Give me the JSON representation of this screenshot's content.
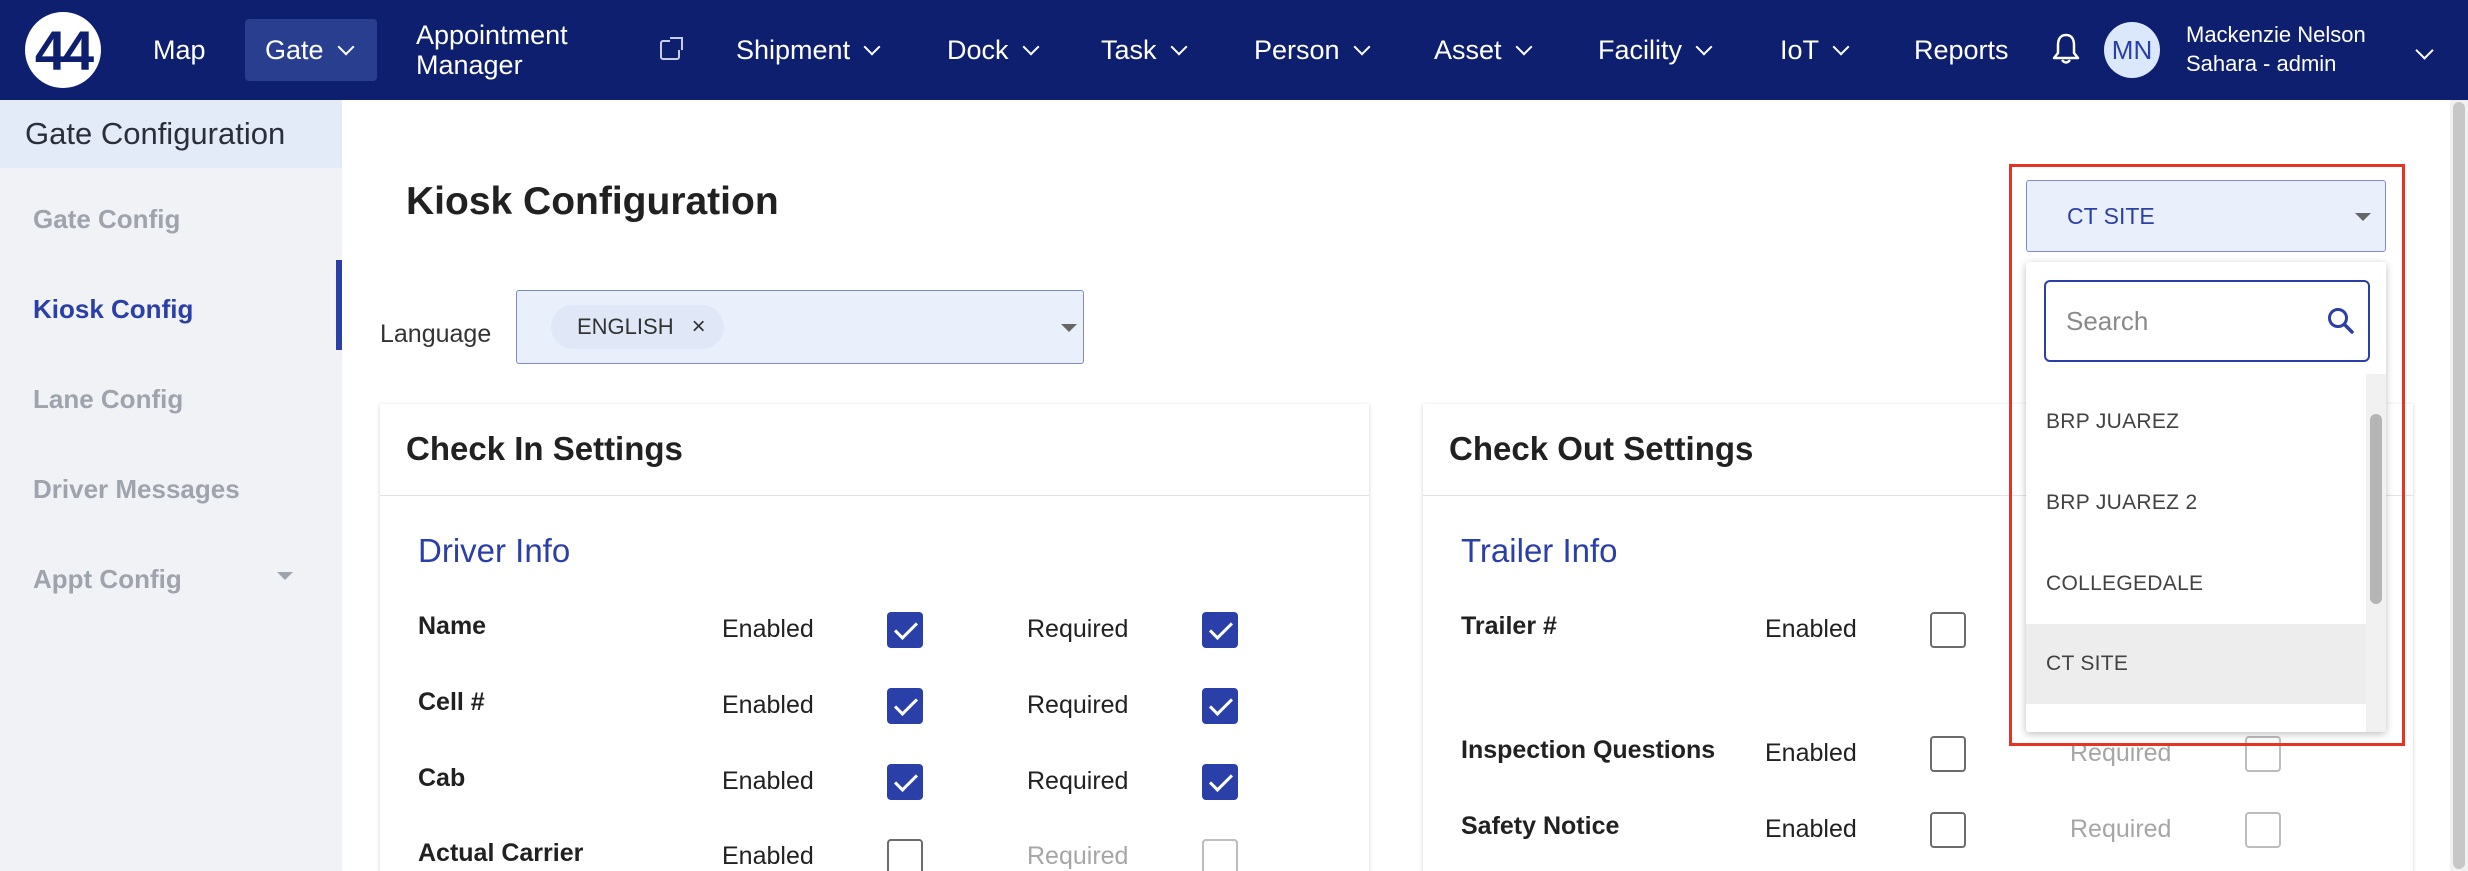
{
  "nav": {
    "logo": "44",
    "items": [
      "Map",
      "Gate",
      "Shipment",
      "Dock",
      "Task",
      "Person",
      "Asset",
      "Facility",
      "IoT",
      "Reports"
    ],
    "appointment_line1": "Appointment",
    "appointment_line2": "Manager",
    "user_initials": "MN",
    "user_name": "Mackenzie Nelson",
    "user_role": "Sahara - admin"
  },
  "sidebar": {
    "header": "Gate Configuration",
    "items": [
      "Gate Config",
      "Kiosk Config",
      "Lane Config",
      "Driver Messages",
      "Appt Config"
    ]
  },
  "main": {
    "title": "Kiosk Configuration",
    "language_label": "Language",
    "language_chip": "ENGLISH",
    "chip_remove": "×"
  },
  "checkin": {
    "title": "Check In Settings",
    "section": "Driver Info",
    "enabled_label": "Enabled",
    "required_label": "Required",
    "rows": [
      {
        "label": "Name",
        "enabled": true,
        "required": true
      },
      {
        "label": "Cell #",
        "enabled": true,
        "required": true
      },
      {
        "label": "Cab",
        "enabled": true,
        "required": true
      },
      {
        "label": "Actual Carrier",
        "enabled": false,
        "required": false
      }
    ]
  },
  "checkout": {
    "title": "Check Out Settings",
    "section": "Trailer Info",
    "enabled_label": "Enabled",
    "required_label": "Required",
    "rows": [
      {
        "label": "Trailer #",
        "enabled": false,
        "required": null
      },
      {
        "label": "Inspection Questions",
        "enabled": false,
        "required": false
      },
      {
        "label": "Safety Notice",
        "enabled": false,
        "required": false
      }
    ]
  },
  "site_dropdown": {
    "value": "CT SITE",
    "search_placeholder": "Search",
    "options": [
      "BRP JUAREZ",
      "BRP JUAREZ 2",
      "COLLEGEDALE",
      "CT SITE"
    ],
    "selected": "CT SITE"
  },
  "colors": {
    "nav_bg": "#0d1f6e",
    "accent": "#2b3fa8",
    "highlight": "#e63322"
  }
}
